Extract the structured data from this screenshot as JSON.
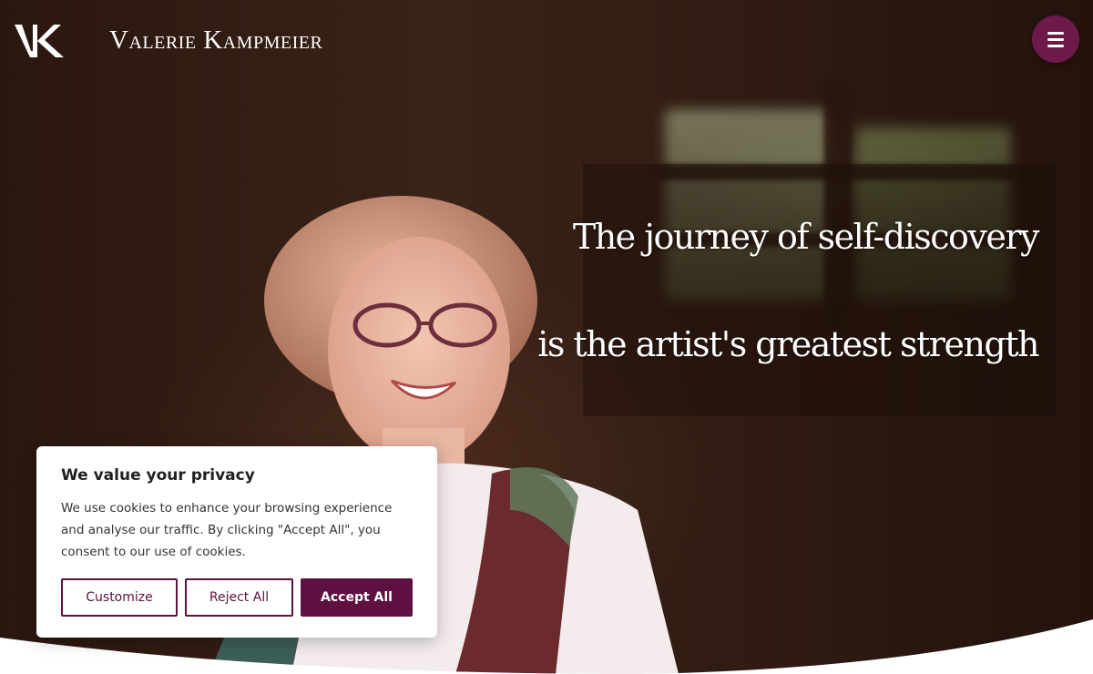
{
  "header": {
    "logo_mark": "VK",
    "brand_name": "Valerie Kampmeier",
    "menu_icon": "hamburger-menu-icon"
  },
  "hero": {
    "quote_line_1": "The journey of self-discovery",
    "quote_line_2": "is the artist's greatest strength"
  },
  "cookie_banner": {
    "title": "We value your privacy",
    "text": "We use cookies to enhance your browsing experience and analyse our traffic. By clicking \"Accept All\", you consent to our use of cookies.",
    "customize_label": "Customize",
    "reject_label": "Reject All",
    "accept_label": "Accept All"
  },
  "colors": {
    "brand_plum": "#5e1141",
    "menu_button": "#6d1a4a",
    "hero_background": "#2a1610"
  }
}
